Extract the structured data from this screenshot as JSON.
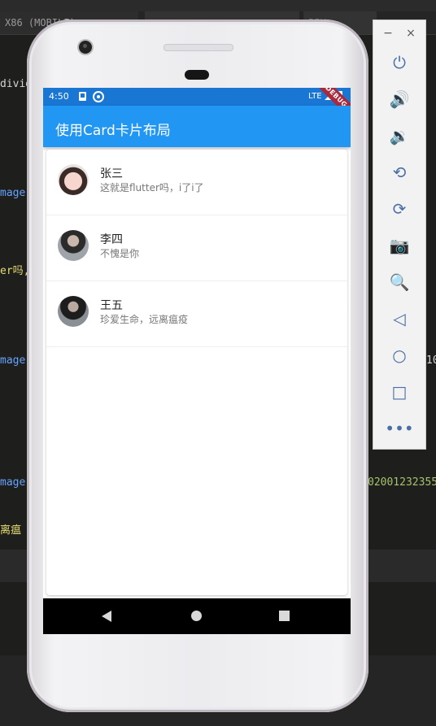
{
  "ide": {
    "tabs": [
      "X86 (MOBILE)",
      "",
      "PIX"
    ],
    "code_fragments": {
      "divid": "divid",
      "image1": "mage",
      "er": "er吗,",
      "image2": "mage",
      "image3": "mage",
      "num_right": "10",
      "long_num": "02001232355",
      "chinese": "离瘟"
    }
  },
  "statusbar": {
    "time": "4:50",
    "lte": "LTE",
    "debug": "DEBUG"
  },
  "appbar": {
    "title": "使用Card卡片布局"
  },
  "list": [
    {
      "name": "张三",
      "subtitle": "这就是flutter吗，i了i了"
    },
    {
      "name": "李四",
      "subtitle": "不愧是你"
    },
    {
      "name": "王五",
      "subtitle": "珍爱生命，远离瘟疫"
    }
  ],
  "emulator": {
    "minimize": "−",
    "close": "×",
    "buttons": [
      "power-icon",
      "volume-up-icon",
      "volume-down-icon",
      "rotate-left-icon",
      "rotate-right-icon",
      "camera-icon",
      "zoom-icon",
      "back-icon",
      "home-icon",
      "overview-icon",
      "more-icon"
    ],
    "glyphs": [
      "⏻",
      "🔊",
      "🔉",
      "⟲",
      "⟳",
      "📷",
      "🔍",
      "◁",
      "○",
      "□",
      "•••"
    ]
  }
}
